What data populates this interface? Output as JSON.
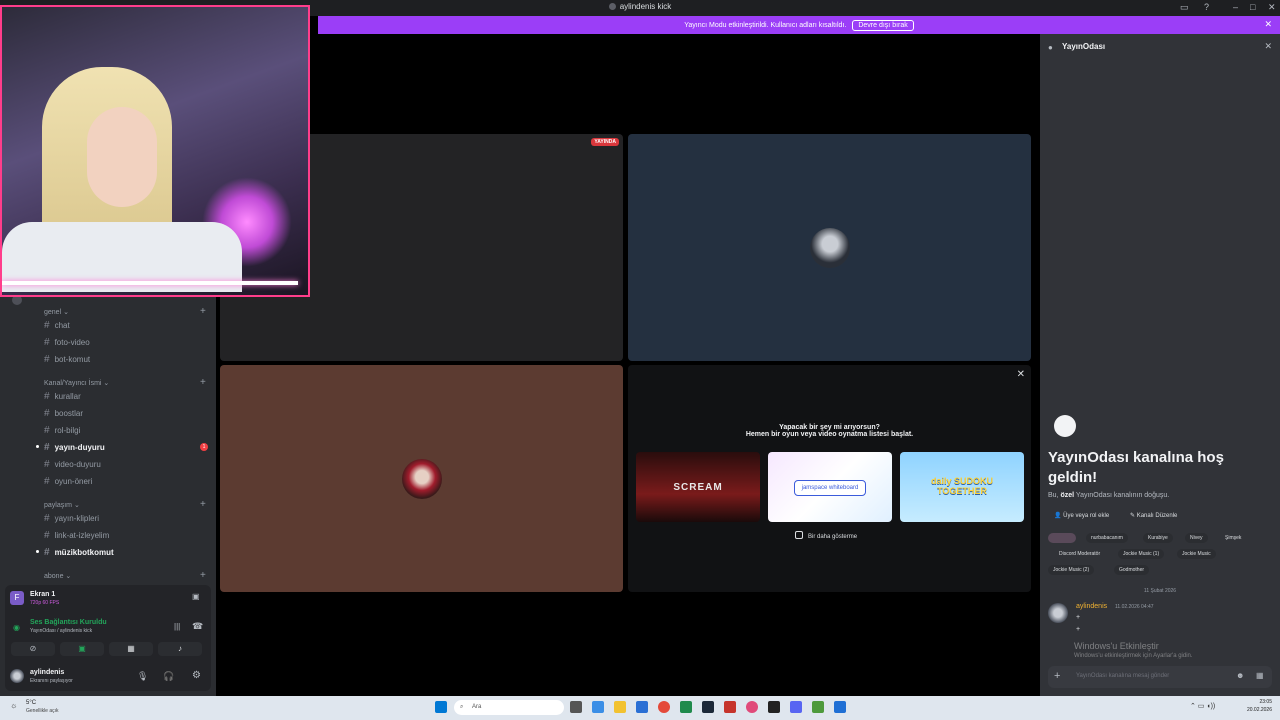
{
  "window": {
    "title": "aylindenis kick"
  },
  "banner": {
    "text": "Yayıncı Modu etkinleştirildi. Kullanıcı adları kısaltıldı.",
    "button": "Devre dışı bırak"
  },
  "sidebar": {
    "categories": [
      {
        "label": "genel ⌄",
        "channels": [
          "chat",
          "foto-video",
          "bot-komut"
        ]
      },
      {
        "label": "Kanal/Yayıncı İsmi ⌄",
        "channels": [
          "kurallar",
          "boostlar",
          "rol-bilgi",
          "yayın-duyuru",
          "video-duyuru",
          "oyun-öneri"
        ]
      },
      {
        "label": "paylaşım ⌄",
        "channels": [
          "yayın-klipleri",
          "link-at-izleyelim",
          "müzikbotkomut"
        ]
      },
      {
        "label": "abone ⌄",
        "channels": []
      }
    ],
    "unread_badge": "1"
  },
  "screen_share": {
    "title": "Ekran 1",
    "subtitle": "720p 60 FPS"
  },
  "voice": {
    "status": "Ses Bağlantısı Kuruldu",
    "channel": "YayınOdası / aylindenis kick"
  },
  "user": {
    "name": "aylindenis",
    "status": "Ekranını paylaşıyor"
  },
  "stage": {
    "live_label": "YAYINDA",
    "activity_prompt_line1": "Yapacak bir şey mi arıyorsun?",
    "activity_prompt_line2": "Hemen bir oyun veya video oynatma listesi başlat.",
    "games": [
      "SCREAM",
      "jamspace whiteboard",
      "daily SUDOKU TOGETHER"
    ],
    "dont_show": "Bir daha gösterme"
  },
  "channel_panel": {
    "name": "YayınOdası",
    "welcome": "YayınOdası kanalına hoş geldin!",
    "desc_pre": "Bu,",
    "desc_bold": "özel",
    "desc_post": "YayınOdası kanalının doğuşu.",
    "add_role": "Üye veya rol ekle",
    "edit_channel": "Kanalı Düzenle",
    "chips": [
      "nurbabacanım",
      "Kurabiye",
      "Nivey",
      "Şimşek",
      "Discord Moderatör",
      "Jockie Music (1)",
      "Jockie Music",
      "Jockie Music (2)",
      "Godmother"
    ],
    "date_divider": "11 Şubat 2026",
    "message": {
      "author": "aylindenis",
      "time": "11.02.2026 04:47",
      "lines": [
        "+",
        "+"
      ]
    },
    "activate_title": "Windows'u Etkinleştir",
    "activate_sub": "Windows'u etkinleştirmek için Ayarlar'a gidin.",
    "input_placeholder": "YayınOdası kanalına mesaj gönder"
  },
  "taskbar": {
    "weather_temp": "5°C",
    "weather_text": "Genellikle açık",
    "search": "Ara",
    "time": "23:05",
    "date": "20.02.2026"
  }
}
